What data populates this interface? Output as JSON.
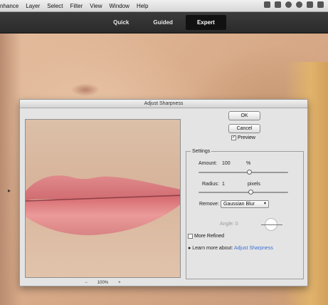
{
  "menubar": {
    "items": [
      "nhance",
      "Layer",
      "Select",
      "Filter",
      "View",
      "Window",
      "Help"
    ],
    "status_icons": [
      "camera-icon",
      "dropbox-icon",
      "sync-icon",
      "wifi-icon",
      "volume-icon",
      "battery-icon"
    ]
  },
  "modes": {
    "quick": "Quick",
    "guided": "Guided",
    "expert": "Expert",
    "active": "Expert"
  },
  "dialog": {
    "title": "Adjust Sharpness",
    "ok_label": "OK",
    "cancel_label": "Cancel",
    "preview_label": "Preview",
    "preview_checked": true,
    "zoom": "100%",
    "zoom_out": "−",
    "zoom_in": "+",
    "settings": {
      "legend": "Settings",
      "amount_label": "Amount:",
      "amount_value": "100",
      "amount_unit": "%",
      "amount_slider": 0.57,
      "radius_label": "Radius:",
      "radius_value": "1",
      "radius_unit": "pixels",
      "radius_slider": 0.58,
      "remove_label": "Remove:",
      "remove_value": "Gaussian Blur",
      "angle_label": "Angle: 0",
      "more_refined_label": "More Refined",
      "more_refined_checked": false,
      "learn_more_label": "Learn more about:",
      "learn_more_link": "Adjust Sharpness"
    }
  },
  "colors": {
    "accent": "#3b6fd6",
    "modebar": "#2f2f2f",
    "lip": "#d9767a"
  }
}
